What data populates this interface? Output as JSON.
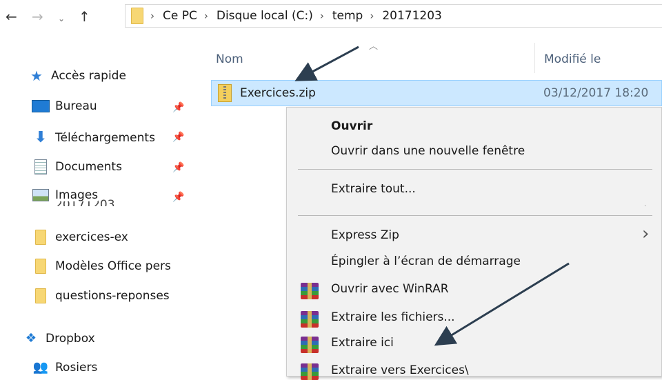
{
  "address_bar": {
    "crumbs": [
      "Ce PC",
      "Disque local (C:)",
      "temp",
      "20171203"
    ]
  },
  "nav_pane": {
    "quick_access": "Accès rapide",
    "items": [
      {
        "label": "Bureau",
        "icon": "desktop-icon",
        "pinned": true
      },
      {
        "label": "Téléchargements",
        "icon": "download-arrow-icon",
        "pinned": true
      },
      {
        "label": "Documents",
        "icon": "document-icon",
        "pinned": true
      },
      {
        "label": "Images",
        "icon": "image-icon",
        "pinned": true
      },
      {
        "label": "exercices-ex",
        "icon": "folder-icon",
        "pinned": false
      },
      {
        "label": "Modèles Office pers",
        "icon": "folder-icon",
        "pinned": false
      },
      {
        "label": "questions-reponses",
        "icon": "folder-icon",
        "pinned": false
      }
    ],
    "overlap_label": "20171203",
    "dropbox": "Dropbox",
    "rosiers": "Rosiers"
  },
  "file_list": {
    "columns": {
      "name": "Nom",
      "modified": "Modifié le"
    },
    "selected_file": {
      "name": "Exercices.zip",
      "modified": "03/12/2017 18:20"
    }
  },
  "context_menu": {
    "open": "Ouvrir",
    "open_new_window": "Ouvrir dans une nouvelle fenêtre",
    "extract_all": "Extraire tout...",
    "express_zip": "Express Zip",
    "pin_start": "Épingler à l’écran de démarrage",
    "open_winrar": "Ouvrir avec WinRAR",
    "extract_files": "Extraire les fichiers...",
    "extract_here": "Extraire ici",
    "extract_to": "Extraire vers Exercices\\"
  },
  "colors": {
    "selection": "#cce8ff",
    "menu_bg": "#f2f2f2",
    "folder": "#f7d774",
    "arrow": "#2c3e50"
  }
}
